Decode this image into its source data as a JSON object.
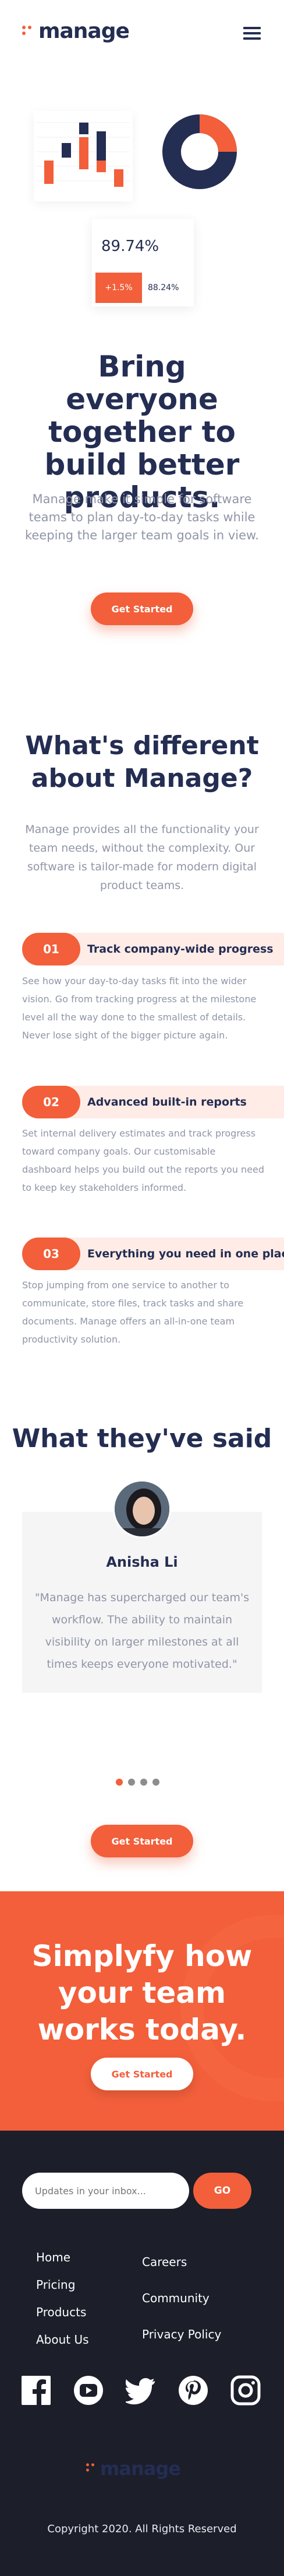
{
  "header": {
    "logo_text": "manage",
    "menu_icon": "hamburger-icon"
  },
  "hero_art": {
    "stat_value": "89.74%",
    "stat_change": "+1.5%",
    "stat_secondary": "88.24%"
  },
  "hero": {
    "title": "Bring everyone together to build better products.",
    "subtitle": "Manage make it simple for software teams to plan day-to-day tasks while keeping the larger team goals in view.",
    "cta_label": "Get Started"
  },
  "different": {
    "title": "What's different about Manage?",
    "subtitle": "Manage provides all the functionality your team needs, without the complexity. Our software is tailor-made for modern digital product teams.",
    "features": [
      {
        "num": "01",
        "title": "Track company-wide progress",
        "desc": "See how your day-to-day tasks fit into the wider vision. Go from tracking progress at the milestone level all the way done to the smallest of details. Never lose sight of the bigger picture again."
      },
      {
        "num": "02",
        "title": "Advanced built-in reports",
        "desc": "Set internal delivery estimates and track progress toward company goals. Our customisable dashboard helps you build out the reports you need to keep key stakeholders informed."
      },
      {
        "num": "03",
        "title": "Everything you need in one place",
        "desc": "Stop jumping from one service to another to communicate, store files, track tasks and share documents. Manage offers an all-in-one team productivity solution."
      }
    ]
  },
  "testimonials": {
    "title": "What they've said",
    "name": "Anisha Li",
    "quote": "\"Manage has supercharged our team's workflow. The ability to maintain visibility on larger milestones at all times keeps everyone motivated.\"",
    "cta_label": "Get Started",
    "active_dot": 0,
    "dot_count": 4
  },
  "cta": {
    "title": "Simplyfy how your team works today.",
    "button_label": "Get Started"
  },
  "footer": {
    "newsletter_placeholder": "Updates in your inbox...",
    "newsletter_button": "GO",
    "links_left": [
      "Home",
      "Pricing",
      "Products",
      "About Us"
    ],
    "links_right": [
      "Careers",
      "Community",
      "Privacy Policy"
    ],
    "socials": [
      "facebook-icon",
      "youtube-icon",
      "twitter-icon",
      "pinterest-icon",
      "instagram-icon"
    ],
    "logo_text": "manage",
    "copyright": "Copyright 2020. All Rights Reserved"
  },
  "colors": {
    "accent": "#f25f3a",
    "navy": "#242d52",
    "grey": "#9095a7",
    "pale": "#ffece7",
    "footer": "#1c1e2a"
  }
}
